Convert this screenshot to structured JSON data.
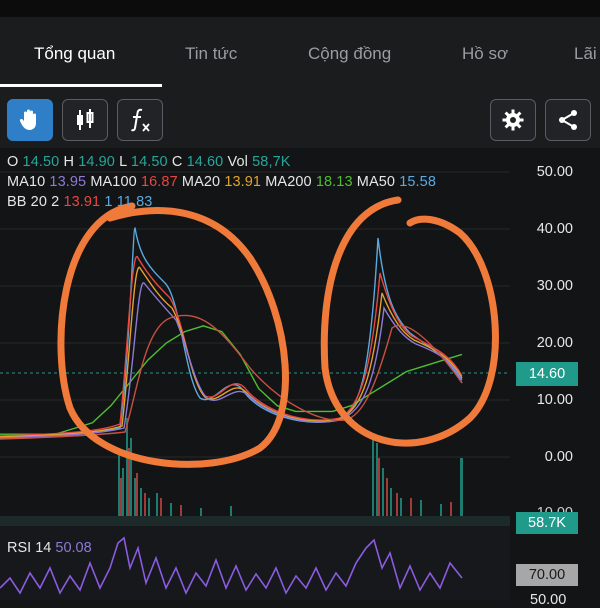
{
  "tabs": [
    {
      "label": "Tổng quan",
      "active": true
    },
    {
      "label": "Tin tức",
      "active": false
    },
    {
      "label": "Cộng đồng",
      "active": false
    },
    {
      "label": "Hồ sơ",
      "active": false
    },
    {
      "label": "Lãi",
      "active": false
    }
  ],
  "toolbar": {
    "tools": [
      "hand-icon",
      "candlestick-icon",
      "function-icon"
    ],
    "right_tools": [
      "gear-icon",
      "share-icon"
    ]
  },
  "legend": {
    "ohlc": [
      {
        "key": "O",
        "value": "14.50"
      },
      {
        "key": "H",
        "value": "14.90"
      },
      {
        "key": "L",
        "value": "14.50"
      },
      {
        "key": "C",
        "value": "14.60"
      },
      {
        "key": "Vol",
        "value": "58,7K"
      }
    ],
    "ma": [
      {
        "key": "MA10",
        "value": "13.95",
        "color": "#8e79d6"
      },
      {
        "key": "MA100",
        "value": "16.87",
        "color": "#e8463f"
      },
      {
        "key": "MA20",
        "value": "13.91",
        "color": "#e3a32b"
      },
      {
        "key": "MA200",
        "value": "18.13",
        "color": "#4fbf2f"
      },
      {
        "key": "MA50",
        "value": "15.58",
        "color": "#5aa9e0"
      }
    ],
    "bb": {
      "key": "BB 20 2",
      "values": [
        "13.91",
        "1",
        "11.83"
      ],
      "colors": [
        "#e8463f",
        "#5aa9e0",
        "#5aa9e0"
      ]
    }
  },
  "y_axis": {
    "ticks": [
      "50.00",
      "40.00",
      "30.00",
      "20.00",
      "10.00",
      "0.00"
    ]
  },
  "last_price": "14.60",
  "volume_value": "58.7K",
  "volume_axis_tick": "10.00",
  "rsi": {
    "label": "RSI 14",
    "value": "50.08",
    "level_high": "70.00",
    "level_low": "50.00"
  },
  "colors": {
    "accent": "#2f7fc8",
    "up": "#1f9a8b",
    "down": "#e8463f",
    "annotation": "#f07a3a"
  },
  "chart_data": {
    "type": "line",
    "ylim": [
      0,
      50
    ],
    "series": [
      {
        "name": "MA200",
        "color": "#4fbf2f",
        "values": [
          4,
          4,
          4,
          4,
          5,
          6,
          9,
          13,
          17,
          20,
          22,
          23,
          22,
          18,
          12,
          9,
          8,
          8,
          8,
          9,
          11,
          13,
          15,
          16,
          17,
          18
        ]
      },
      {
        "name": "MA50",
        "color": "#5aa9e0",
        "values": [
          4,
          4,
          4,
          4,
          5,
          36,
          34,
          30,
          28,
          20,
          14,
          12,
          11,
          6,
          5,
          5,
          6,
          28,
          22,
          20,
          18,
          17,
          16,
          15,
          15,
          15
        ]
      }
    ]
  }
}
